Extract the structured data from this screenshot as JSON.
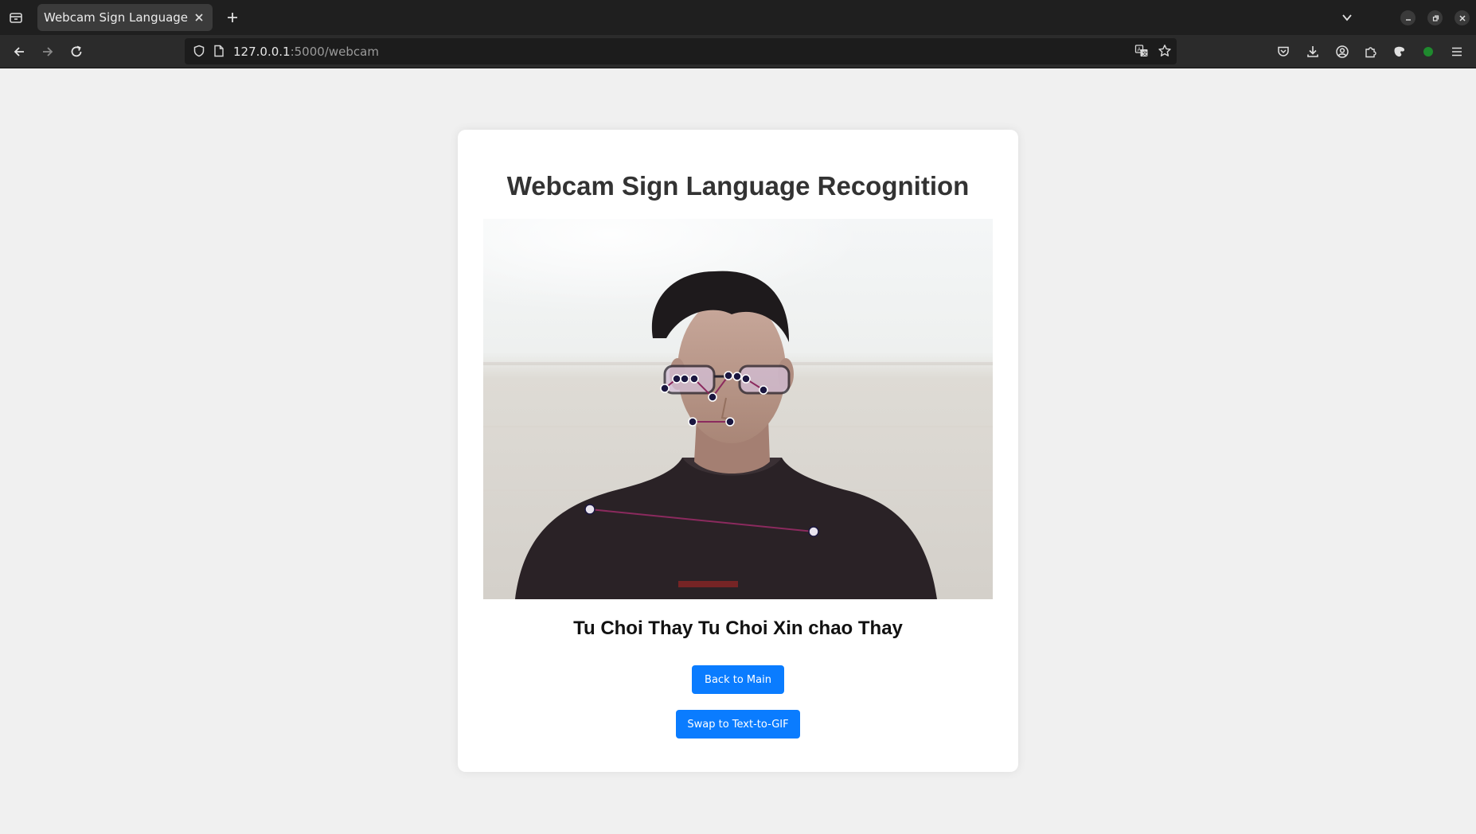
{
  "browser": {
    "tab_title": "Webcam Sign Language Recognition",
    "url_host": "127.0.0.1",
    "url_rest": ":5000/webcam"
  },
  "icons": {
    "tab_list": "tab-list-icon",
    "tab_close": "close-icon",
    "new_tab": "plus-icon",
    "back": "arrow-left-icon",
    "forward": "arrow-right-icon",
    "reload": "reload-icon",
    "tracking": "shield-icon",
    "page_info": "page-icon",
    "translate": "translate-icon",
    "bookmark": "star-icon",
    "pocket": "pocket-icon",
    "downloads": "download-icon",
    "account": "account-icon",
    "extensions": "puzzle-icon",
    "menu": "hamburger-icon"
  },
  "page": {
    "title": "Webcam Sign Language Recognition",
    "prediction": "Tu Choi Thay Tu Choi Xin chao Thay",
    "back_button": "Back to Main",
    "swap_button": "Swap to Text-to-GIF"
  },
  "colors": {
    "accent": "#0a7cff",
    "page_bg": "#f0f0f0",
    "card_bg": "#ffffff",
    "title": "#333333",
    "landmark_line": "#8b2a5e",
    "landmark_point": "#1b1740"
  }
}
